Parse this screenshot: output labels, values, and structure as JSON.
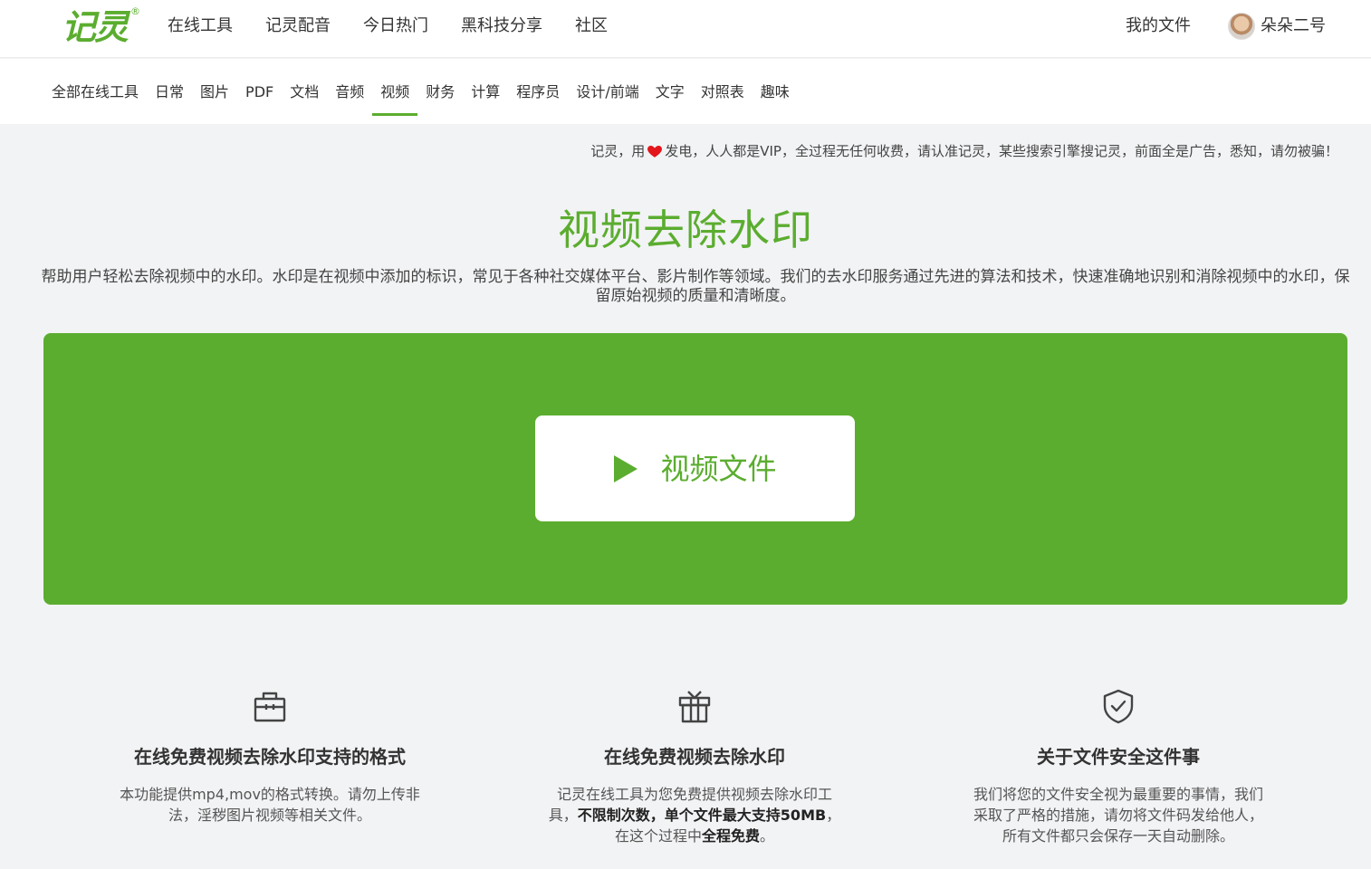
{
  "brand": {
    "logo_text": "记灵",
    "logo_mark": "®",
    "color": "#5bad2f"
  },
  "topnav": [
    {
      "label": "在线工具"
    },
    {
      "label": "记灵配音"
    },
    {
      "label": "今日热门"
    },
    {
      "label": "黑科技分享"
    },
    {
      "label": "社区"
    }
  ],
  "header_right": {
    "my_files": "我的文件",
    "username": "朵朵二号"
  },
  "subnav": [
    {
      "label": "全部在线工具"
    },
    {
      "label": "日常"
    },
    {
      "label": "图片"
    },
    {
      "label": "PDF"
    },
    {
      "label": "文档"
    },
    {
      "label": "音频"
    },
    {
      "label": "视频",
      "active": true
    },
    {
      "label": "财务"
    },
    {
      "label": "计算"
    },
    {
      "label": "程序员"
    },
    {
      "label": "设计/前端"
    },
    {
      "label": "文字"
    },
    {
      "label": "对照表"
    },
    {
      "label": "趣味"
    }
  ],
  "notice": {
    "before": "记灵，用",
    "after": "发电，人人都是VIP，全过程无任何收费，请认准记灵，某些搜索引擎搜记灵，前面全是广告，悉知，请勿被骗！"
  },
  "page": {
    "title": "视频去除水印",
    "description": "帮助用户轻松去除视频中的水印。水印是在视频中添加的标识，常见于各种社交媒体平台、影片制作等领域。我们的去水印服务通过先进的算法和技术，快速准确地识别和消除视频中的水印，保留原始视频的质量和清晰度。"
  },
  "upload": {
    "label": "视频文件",
    "icon": "play-icon"
  },
  "features": [
    {
      "icon": "toolbox-icon",
      "title": "在线免费视频去除水印支持的格式",
      "text_lines": [
        "本功能提供mp4,mov的格式转换。请勿上传非",
        "法，淫秽图片视频等相关文件。"
      ]
    },
    {
      "icon": "gift-icon",
      "title": "在线免费视频去除水印",
      "p1": "记灵在线工具为您免费提供视频去除水印工",
      "p2_pre": "具，",
      "p2_bold": "不限制次数，单个文件最大支持50MB",
      "p2_post": "，",
      "p3_pre": "在这个过程中",
      "p3_bold": "全程免费",
      "p3_post": "。"
    },
    {
      "icon": "shield-check-icon",
      "title": "关于文件安全这件事",
      "text_lines": [
        "我们将您的文件安全视为最重要的事情，我们",
        "采取了严格的措施，请勿将文件码发给他人，",
        "所有文件都只会保存一天自动删除。"
      ]
    }
  ]
}
